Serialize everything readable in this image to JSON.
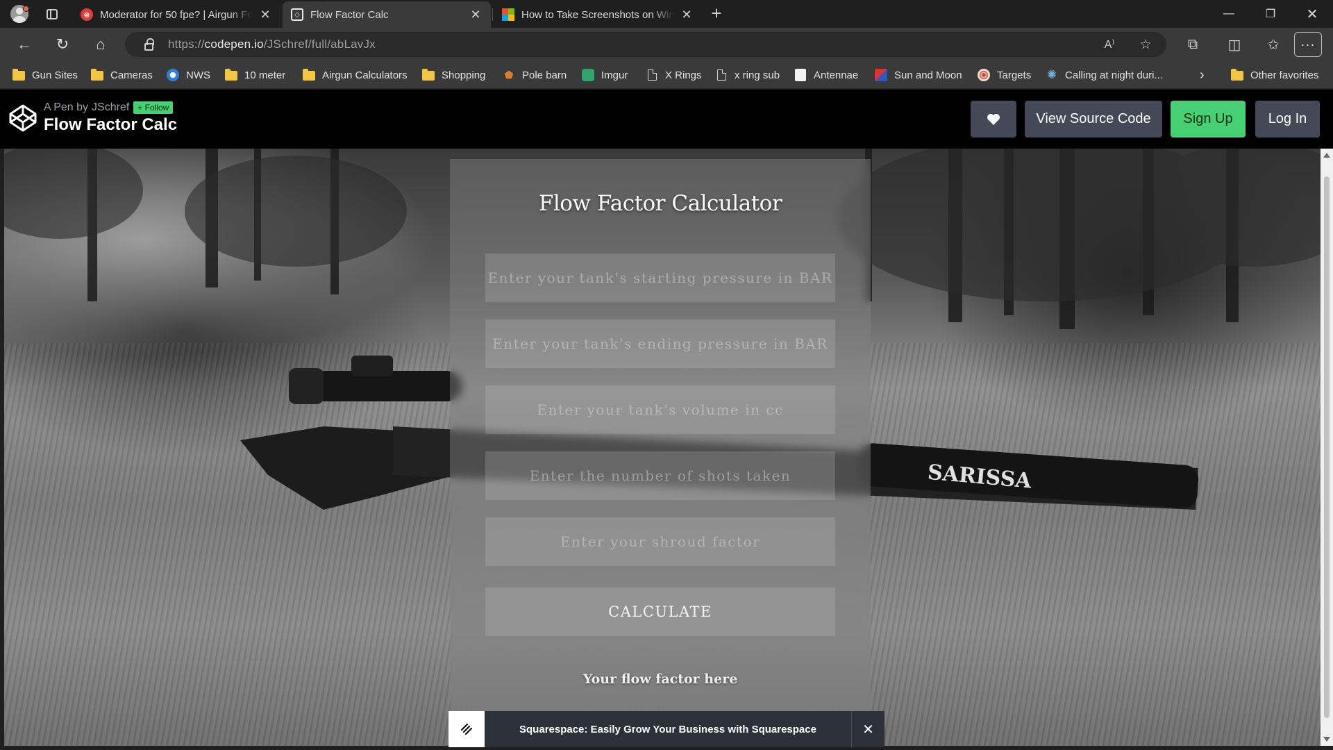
{
  "browser": {
    "tabs": [
      {
        "title": "Moderator for 50 fpe? | Airgun Forum",
        "active": false
      },
      {
        "title": "Flow Factor Calc",
        "active": true
      },
      {
        "title": "How to Take Screenshots on Windows",
        "active": false
      }
    ],
    "url_prefix": "https://",
    "url_host": "codepen.io",
    "url_path": "/JSchref/full/abLavJx"
  },
  "bookmarks": [
    {
      "label": "Gun Sites",
      "icon": "folder-icon"
    },
    {
      "label": "Cameras",
      "icon": "folder-icon"
    },
    {
      "label": "NWS",
      "icon": "nws-icon"
    },
    {
      "label": "10 meter",
      "icon": "folder-icon"
    },
    {
      "label": "Airgun Calculators",
      "icon": "folder-icon"
    },
    {
      "label": "Shopping",
      "icon": "folder-icon"
    },
    {
      "label": "Pole barn",
      "icon": "pole-barn-icon"
    },
    {
      "label": "Imgur",
      "icon": "imgur-icon"
    },
    {
      "label": "X Rings",
      "icon": "page-icon"
    },
    {
      "label": "x ring sub",
      "icon": "page-icon"
    },
    {
      "label": "Antennae",
      "icon": "antennae-icon"
    },
    {
      "label": "Sun and Moon",
      "icon": "sun-moon-icon"
    },
    {
      "label": "Targets",
      "icon": "targets-icon"
    },
    {
      "label": "Calling at night duri...",
      "icon": "gear-icon"
    }
  ],
  "other_favorites": "Other favorites",
  "codepen": {
    "byline_prefix": "A Pen by",
    "author": "JSchref",
    "follow_label": "+ Follow",
    "pen_title": "Flow Factor Calc",
    "view_source_label": "View Source Code",
    "signup_label": "Sign Up",
    "login_label": "Log In"
  },
  "calculator": {
    "title": "Flow Factor Calculator",
    "fields": [
      {
        "placeholder": "Enter your tank's starting pressure in BAR"
      },
      {
        "placeholder": "Enter your tank's ending pressure in BAR"
      },
      {
        "placeholder": "Enter your tank's volume in cc"
      },
      {
        "placeholder": "Enter the number of shots taken"
      },
      {
        "placeholder": "Enter your shroud factor"
      }
    ],
    "button_label": "CALCULATE",
    "result_text": "Your flow factor here"
  },
  "ad": {
    "text": "Squarespace: Easily Grow Your Business with Squarespace",
    "close": "✕"
  },
  "scene": {
    "silencer_brand": "SARISSA"
  }
}
